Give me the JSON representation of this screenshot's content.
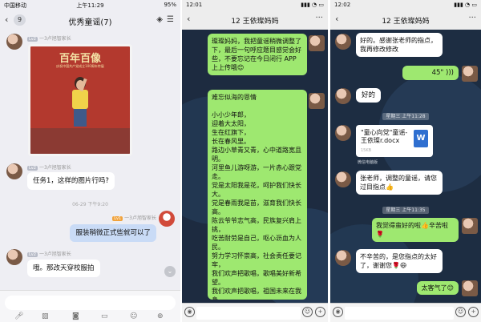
{
  "panel1": {
    "status": {
      "carrier": "中国移动",
      "time": "上午11:29",
      "battery": "95%"
    },
    "nav": {
      "back": "‹",
      "badge": "9",
      "title": "优秀童谣(7)"
    },
    "messages": [
      {
        "meta": "一3卢旭智家长",
        "level": "Lv2"
      },
      {
        "photo_title": "百年百像",
        "photo_subtitle": "庆祝中国共产党成立100周年特展"
      },
      {
        "meta": "一3卢旭智家长",
        "level": "Lv2"
      },
      {
        "text": "任务1，这样的图片行吗?"
      },
      {
        "time": "06-29 下午9:20"
      },
      {
        "meta": "一3卢旭智家长",
        "level": "Lv1"
      },
      {
        "text": "服装稍微正式些就可以了"
      },
      {
        "meta": "一3卢旭智家长",
        "level": "Lv2"
      },
      {
        "text": "哦。那改天穿校服拍"
      }
    ],
    "colors": {
      "accent": "#c9dbf6"
    }
  },
  "panel2": {
    "status": {
      "time": "12:01"
    },
    "nav": {
      "back": "‹",
      "title": "12 王依璨妈妈",
      "more": "···"
    },
    "msg1": "璨璨妈妈，我把童谣稍微调整了下，最后一句呼应题目感觉会好些，不要忘记在今日闭行 APP 上上传哦😊",
    "msg2": "难忘似海的恩情\n\n小小少年郎，\n迎着大太阳，\n生在红旗下，\n长在春风里。\n路边小草青又青，心中道路宽且明。\n河里鱼儿游呀游，一片赤心跟党走。\n党是太阳我是花，呵护我们快长大。\n党是春雨我是苗，滋育我们快长高。\n陈云爷爷志气高，民族复兴肩上挑，\n吃苦耐劳是自己，呕心沥血为人民。\n努力学习怀崇高，社会责任要记牢，\n我们欢声把歌唱，歌唱美好新希望。\n我们欢声把歌唱，祖国未来在我身"
  },
  "panel3": {
    "status": {
      "time": "12:02"
    },
    "nav": {
      "back": "‹",
      "title": "12 王依璨妈妈",
      "more": "···"
    },
    "msg1": "好的。感谢张老师的指点，我再修改修改",
    "msg2": "45\"",
    "msg3": "好的",
    "time1": "星期三 上午11:28",
    "file": {
      "name": "\"童心向党\"童谣-王依璨r.docx",
      "size": "15KB",
      "source": "微信电脑版",
      "icon": "W"
    },
    "msg4": "张老师，调整的童谣，请您过目指点👍",
    "time2": "星期三 上午11:35",
    "msg5": "我觉得蛮好的啦👍辛苦啦🌹",
    "msg6": "不辛苦的，是您指点的太好了，谢谢您🌹😄",
    "msg7": "太客气了😊"
  }
}
